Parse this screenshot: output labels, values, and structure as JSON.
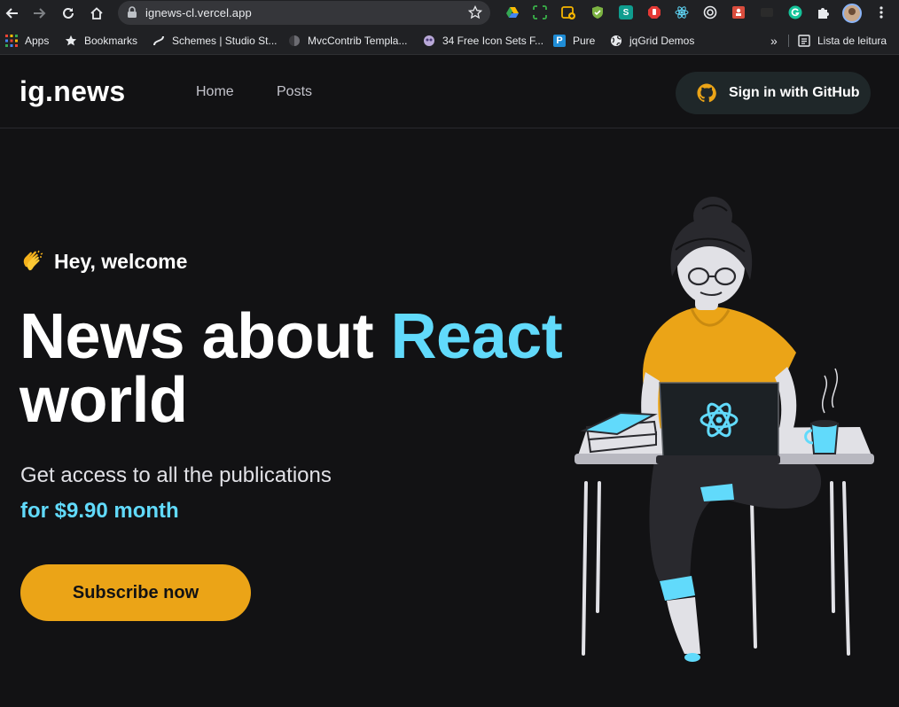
{
  "browser": {
    "url": "ignews-cl.vercel.app",
    "bookmarks": [
      {
        "label": "Apps",
        "icon": "apps-grid-icon"
      },
      {
        "label": "Bookmarks",
        "icon": "star-icon"
      },
      {
        "label": "Schemes | Studio St...",
        "icon": "studio-icon"
      },
      {
        "label": "MvcContrib Templa...",
        "icon": "codeplex-icon"
      },
      {
        "label": "34 Free Icon Sets F...",
        "icon": "iconset-icon"
      },
      {
        "label": "Pure",
        "icon": "pure-p-icon"
      },
      {
        "label": "jqGrid Demos",
        "icon": "globe-icon"
      }
    ],
    "overflow": "»",
    "reading_list": "Lista de leitura"
  },
  "header": {
    "logo": "ig.news",
    "nav": [
      "Home",
      "Posts"
    ],
    "signin_label": "Sign in with GitHub"
  },
  "hero": {
    "greeting": "Hey, welcome",
    "headline_part1": "News about ",
    "headline_accent": "React",
    "headline_part2": "world",
    "subtitle": "Get access to all the publications",
    "price": "for $9.90 month",
    "cta": "Subscribe now"
  },
  "colors": {
    "background": "#121214",
    "accent_cyan": "#61dafb",
    "accent_yellow": "#eba417",
    "text_muted": "#c4c4cc"
  }
}
